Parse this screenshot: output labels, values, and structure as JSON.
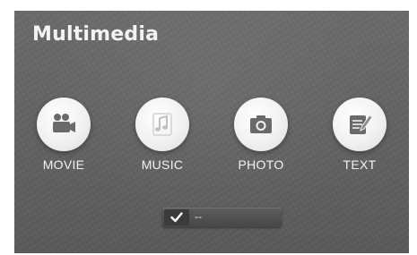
{
  "header": {
    "title": "Multimedia"
  },
  "apps": [
    {
      "label": "MOVIE",
      "icon": "movie-camera-icon"
    },
    {
      "label": "MUSIC",
      "icon": "music-note-icon"
    },
    {
      "label": "PHOTO",
      "icon": "camera-icon"
    },
    {
      "label": "TEXT",
      "icon": "document-pencil-icon"
    }
  ],
  "status": {
    "icon": "checkmark-icon",
    "text": "--"
  },
  "colors": {
    "background": "#626262",
    "icon_circle": "#f1f1f1",
    "icon_glyph": "#6a6a6a",
    "text": "#f2f2f2"
  }
}
